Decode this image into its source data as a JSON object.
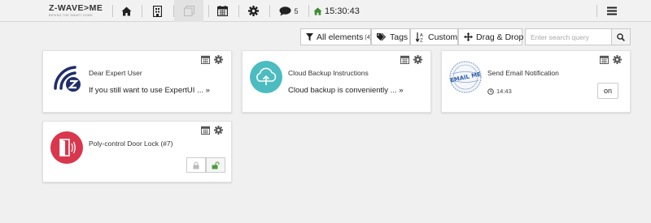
{
  "header": {
    "logo_text": "Z-WAVE>ME",
    "logo_tagline": "BEHIND THE SMART HOME",
    "nav": [
      {
        "name": "home",
        "icon": "home-icon"
      },
      {
        "name": "rooms",
        "icon": "rooms-icon"
      },
      {
        "name": "elements",
        "icon": "elements-icon"
      },
      {
        "name": "events",
        "icon": "calendar-icon"
      },
      {
        "name": "settings",
        "icon": "gear-icon"
      },
      {
        "name": "notifications",
        "icon": "comment-icon"
      },
      {
        "name": "time",
        "icon": "home-icon"
      }
    ],
    "notification_count": "5",
    "clock": "15:30:43",
    "menu_icon": "hamburger-icon",
    "accent_color": "#3c8d2f"
  },
  "toolbar": {
    "all_label": "All elements",
    "all_count": "(4)",
    "tags_label": "Tags",
    "custom_label": "Custom",
    "drag_label": "Drag & Drop",
    "search_placeholder": "Enter search query"
  },
  "widgets": [
    {
      "title": "Dear Expert User",
      "text": "If you still want to use ExpertUI ... »",
      "icon": "zwave-logo-icon"
    },
    {
      "title": "Cloud Backup Instructions",
      "text": "Cloud backup is conveniently ... »",
      "icon": "cloud-upload-icon"
    },
    {
      "title": "Send Email Notification",
      "time": "14:43",
      "button": "on",
      "icon": "email-stamp-icon",
      "stamp_text": "EMAIL ME"
    },
    {
      "title": "Poly-control Door Lock (#7)",
      "icon": "door-lock-icon"
    }
  ],
  "colors": {
    "cloud_teal": "#4cbcc0",
    "lock_red": "#d8374d",
    "unlock_green": "#4f9a3b"
  }
}
